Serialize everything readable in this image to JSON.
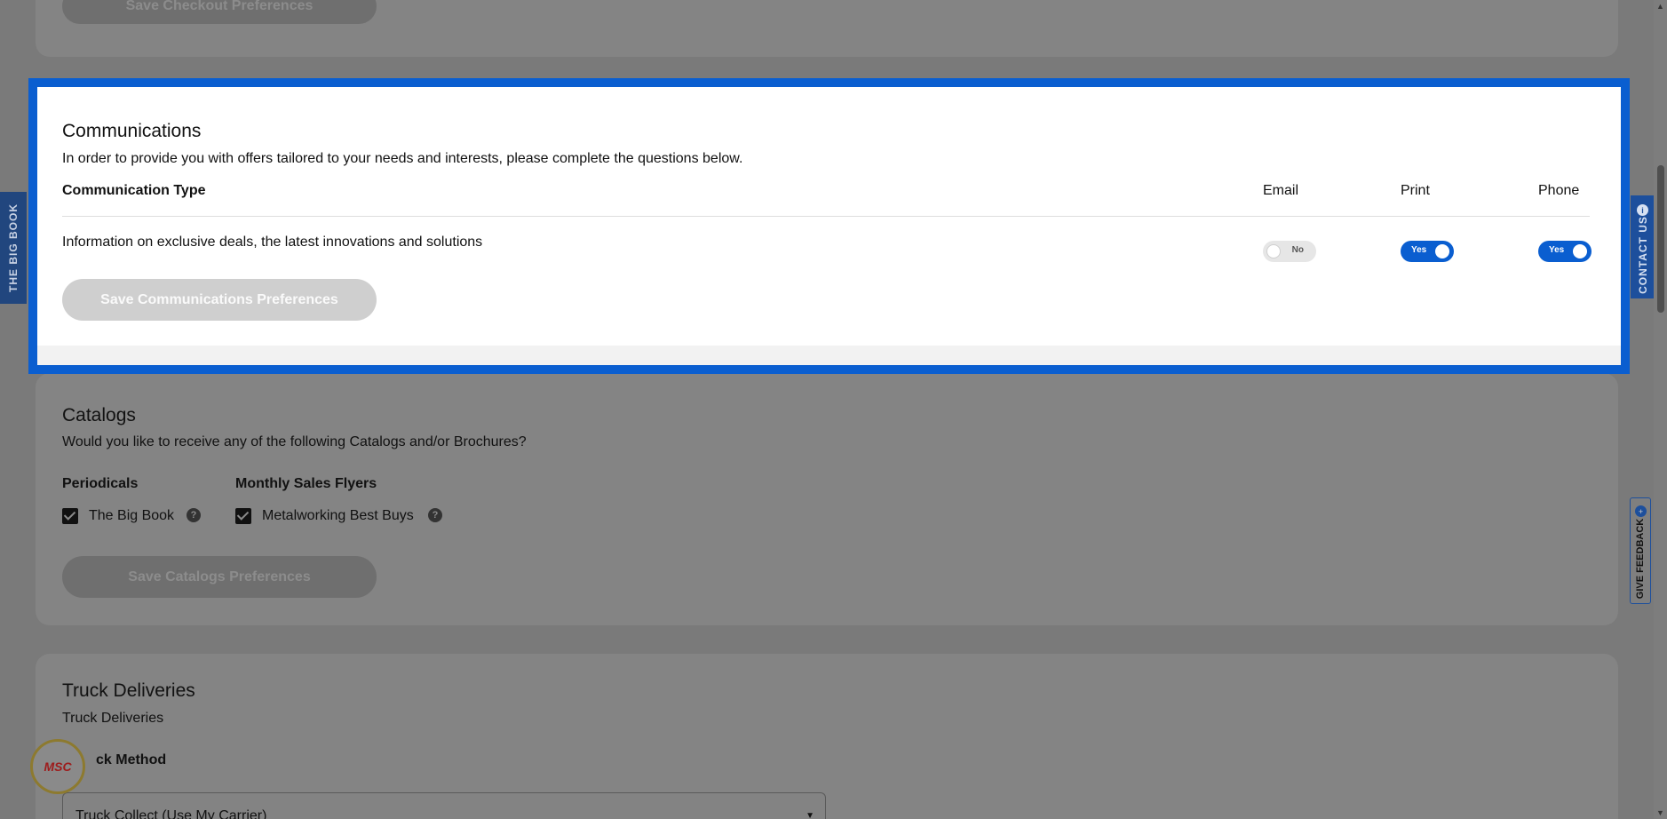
{
  "checkout": {
    "save_label": "Save Checkout Preferences"
  },
  "communications": {
    "title": "Communications",
    "description": "In order to provide you with offers tailored to your needs and interests, please complete the questions below.",
    "columns": {
      "type": "Communication Type",
      "email": "Email",
      "print": "Print",
      "phone": "Phone"
    },
    "row_label": "Information on exclusive deals, the latest innovations and solutions",
    "toggles": {
      "email": "No",
      "print": "Yes",
      "phone": "Yes"
    },
    "save_label": "Save Communications Preferences"
  },
  "catalogs": {
    "title": "Catalogs",
    "description": "Would you like to receive any of the following Catalogs and/or Brochures?",
    "groups": [
      {
        "heading": "Periodicals",
        "item": "The Big Book"
      },
      {
        "heading": "Monthly Sales Flyers",
        "item": "Metalworking Best Buys"
      }
    ],
    "save_label": "Save Catalogs Preferences"
  },
  "truck": {
    "title": "Truck Deliveries",
    "subtitle": "Truck Deliveries",
    "method_label": "Truck Method",
    "method_label_visible": "ck Method",
    "method_value": "Truck Collect (Use My Carrier)"
  },
  "side": {
    "left_tab": "THE BIG BOOK",
    "contact_tab": "CONTACT US",
    "feedback_tab": "GIVE FEEDBACK"
  },
  "logo": "MSC",
  "icons": {
    "help": "question-icon",
    "info": "info-icon",
    "caret": "chevron-down-icon"
  },
  "colors": {
    "accent": "#0a5ed0",
    "overlay": "#7a7a7a"
  }
}
